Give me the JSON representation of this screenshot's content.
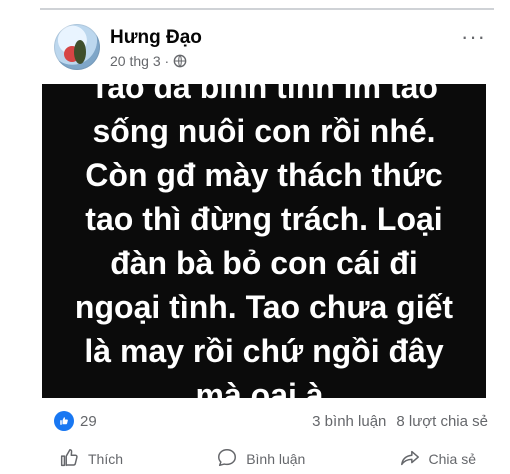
{
  "post": {
    "author": "Hưng Đạo",
    "timestamp": "20 thg 3 ·",
    "privacy_icon": "globe-icon",
    "more_icon": "more-options-icon",
    "image_text": "Tao đã bình tĩnh im tao sống nuôi con rồi nhé. Còn gđ mày thách thức tao thì đừng trách. Loại đàn bà bỏ con cái đi ngoại tình. Tao chưa giết là may rồi chứ ngồi đây mà oai à.",
    "reactions": {
      "icon": "like-icon",
      "count": "29"
    },
    "comments_count": "3 bình luận",
    "shares_count": "8 lượt chia sẻ"
  },
  "actions": {
    "like": "Thích",
    "comment": "Bình luận",
    "share": "Chia sẻ"
  },
  "colors": {
    "accent": "#1877f2",
    "post_image_bg": "#0b0b0b",
    "secondary_text": "#65676b"
  }
}
